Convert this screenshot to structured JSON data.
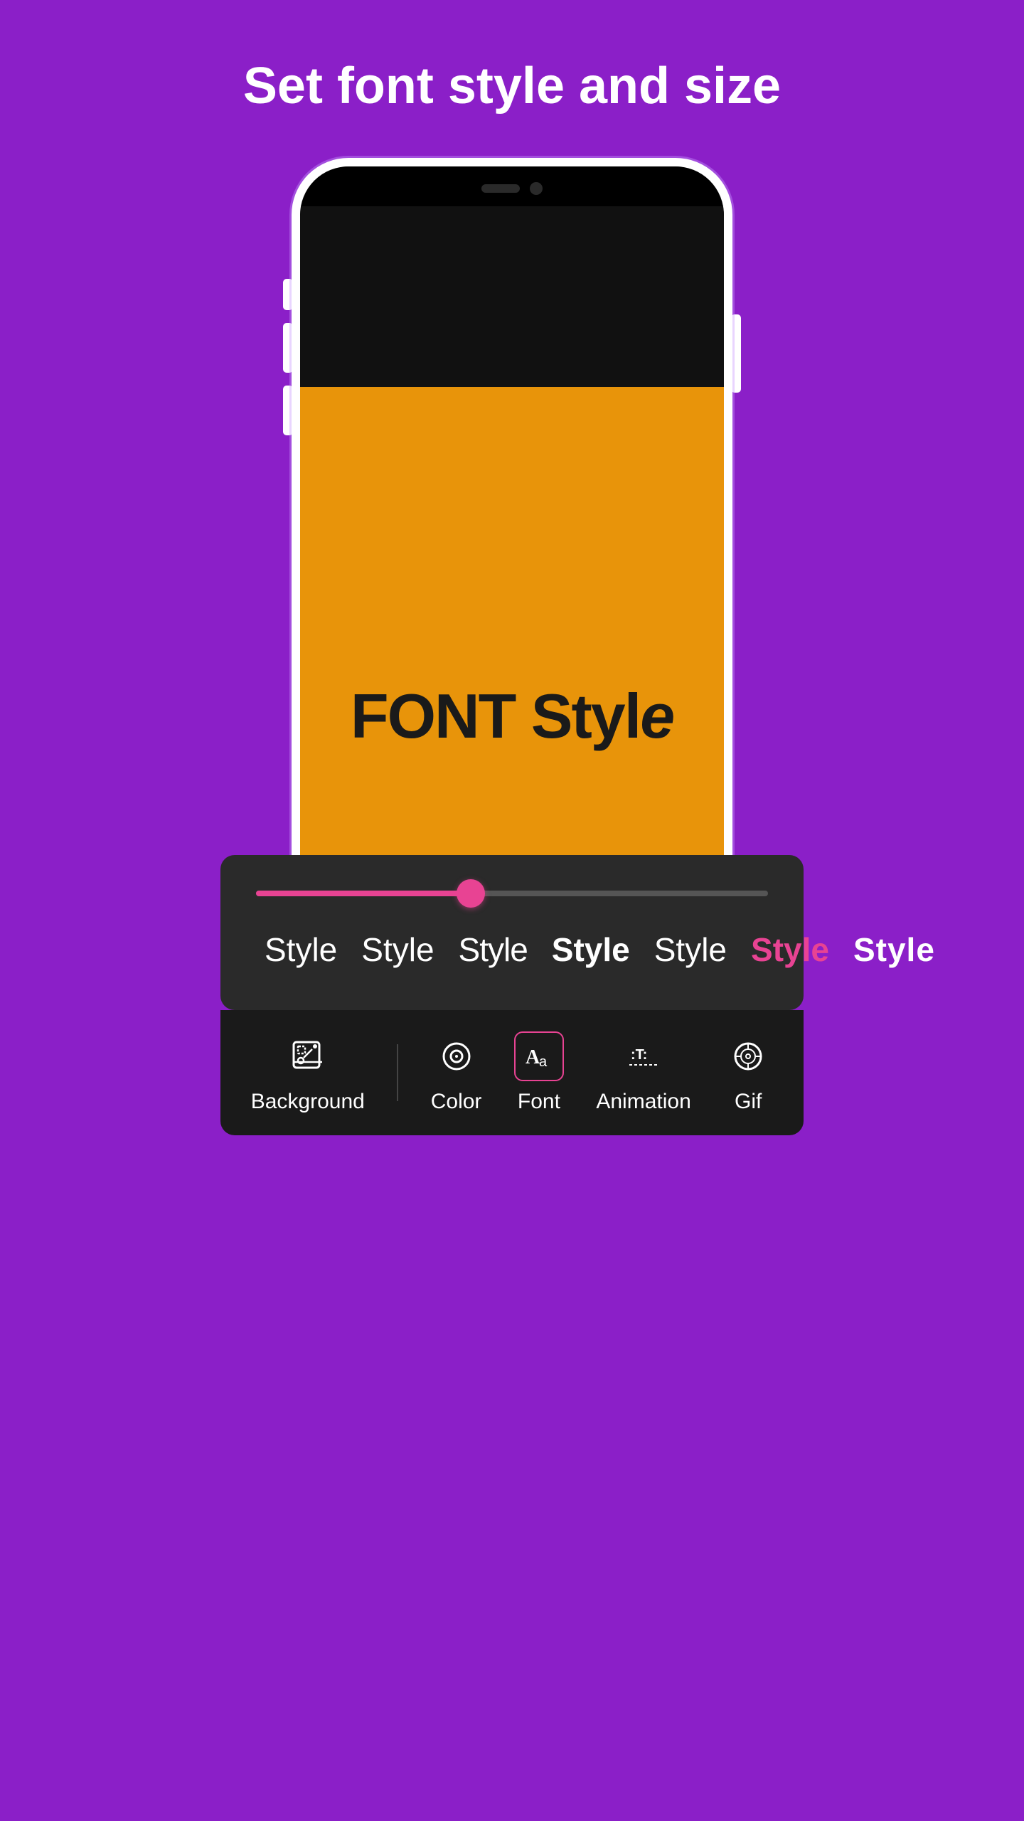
{
  "header": {
    "title": "Set font style and size"
  },
  "phone": {
    "font_text_main": "FONT Styl",
    "font_text_italic": "e"
  },
  "slider": {
    "fill_percent": 42
  },
  "style_options": [
    {
      "id": "style-1",
      "label": "Style",
      "weight": "thin"
    },
    {
      "id": "style-2",
      "label": "Style",
      "weight": "light"
    },
    {
      "id": "style-3",
      "label": "Style",
      "weight": "regular"
    },
    {
      "id": "style-4",
      "label": "Style",
      "weight": "bold"
    },
    {
      "id": "style-5",
      "label": "Style",
      "weight": "medium"
    },
    {
      "id": "style-6",
      "label": "Style",
      "weight": "active"
    },
    {
      "id": "style-7",
      "label": "Style",
      "weight": "extra"
    }
  ],
  "toolbar": {
    "items": [
      {
        "id": "background",
        "label": "Background",
        "active": false
      },
      {
        "id": "color",
        "label": "Color",
        "active": false
      },
      {
        "id": "font",
        "label": "Font",
        "active": true
      },
      {
        "id": "animation",
        "label": "Animation",
        "active": false
      },
      {
        "id": "gif",
        "label": "Gif",
        "active": false
      }
    ]
  },
  "colors": {
    "bg_purple": "#8B1FC8",
    "orange": "#E8940A",
    "pink": "#e84393",
    "dark_panel": "#2a2a2a",
    "toolbar_bg": "#1a1a1a"
  }
}
